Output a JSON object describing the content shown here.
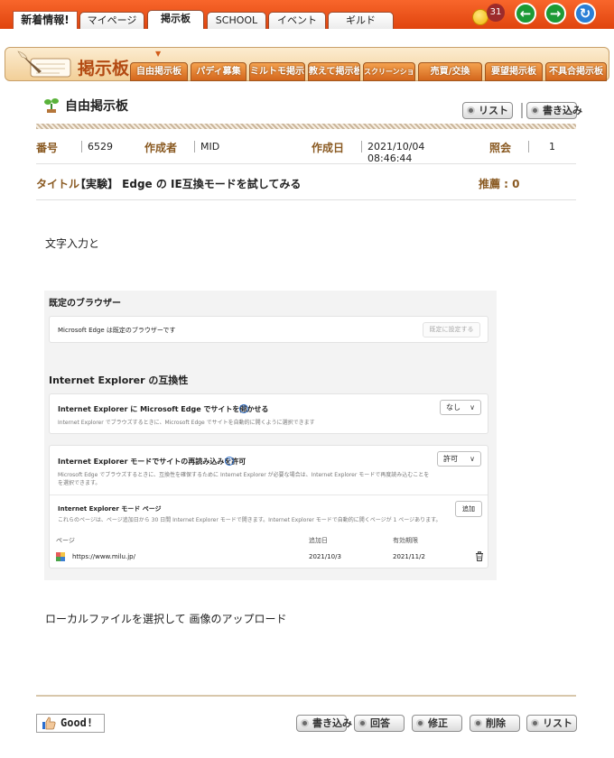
{
  "topnav": {
    "new_info": "新着情報!",
    "tabs": [
      {
        "label": "マイページ"
      },
      {
        "label": "掲示板"
      },
      {
        "label": "SCHOOL"
      },
      {
        "label": "イベント"
      },
      {
        "label": "ギルド"
      }
    ],
    "active_tab": "掲示板",
    "notification_count": "31",
    "colors": {
      "bar": "#f0561a",
      "back": "#1c9a35",
      "forward": "#1c9a35",
      "refresh": "#2b7fd6"
    }
  },
  "board": {
    "title": "掲示板",
    "marker": "▼",
    "tabs": [
      {
        "label": "自由掲示板"
      },
      {
        "label": "パディ募集"
      },
      {
        "label": "ミルトモ掲示板"
      },
      {
        "label": "教えて掲示板"
      },
      {
        "label": "スクリーンショット"
      },
      {
        "label": "売買/交換"
      },
      {
        "label": "要望掲示板"
      },
      {
        "label": "不具合掲示板"
      }
    ]
  },
  "post": {
    "board_name": "自由掲示板",
    "list_label": "リスト",
    "write_label": "書き込み",
    "meta": {
      "number_label": "番号",
      "number": "6529",
      "author_label": "作成者",
      "author": "MID",
      "date_label": "作成日",
      "date": "2021/10/04 08:46:44",
      "views_label": "照会",
      "views": "1"
    },
    "title_label": "タイトル",
    "title": "【実験】 Edge の IE互換モードを試してみる",
    "recommend_label": "推薦 : 0",
    "body_line1": "文字入力と",
    "body_line2": "ローカルファイルを選択して 画像のアップロード"
  },
  "screenshot": {
    "default_browser_heading": "既定のブラウザー",
    "default_browser_text": "Microsoft Edge は既定のブラウザーです",
    "set_default_button": "既定に設定する",
    "ie_heading": "Internet Explorer の互換性",
    "open_in_edge_title": "Internet Explorer に Microsoft Edge でサイトを開かせる",
    "open_in_edge_desc": "Internet Explorer でブラウズするときに、Microsoft Edge でサイトを自動的に開くように選択できます",
    "open_in_edge_value": "なし",
    "reload_title": "Internet Explorer モードでサイトの再読み込みを許可",
    "reload_desc1": "Microsoft Edge でブラウズするときに、互換性を確保するために Internet Explorer が必要な場合は、Internet Explorer モードで再度読み込むことを",
    "reload_desc2": "を選択できます。",
    "reload_value": "許可",
    "pages_title": "Internet Explorer モード ページ",
    "pages_desc": "これらのページは、ページ追加日から 30 日間 Internet Explorer モードで開きます。Internet Explorer モードで自動的に開くページが 1 ページあります。",
    "add_button": "追加",
    "col_page": "ページ",
    "col_added": "追加日",
    "col_expires": "有効期限",
    "row_url": "https://www.milu.jp/",
    "row_added": "2021/10/3",
    "row_expires": "2021/11/2"
  },
  "footer": {
    "good": "Good!",
    "buttons": [
      {
        "label": "書き込み"
      },
      {
        "label": "回答"
      },
      {
        "label": "修正"
      },
      {
        "label": "削除"
      },
      {
        "label": "リスト"
      }
    ]
  }
}
